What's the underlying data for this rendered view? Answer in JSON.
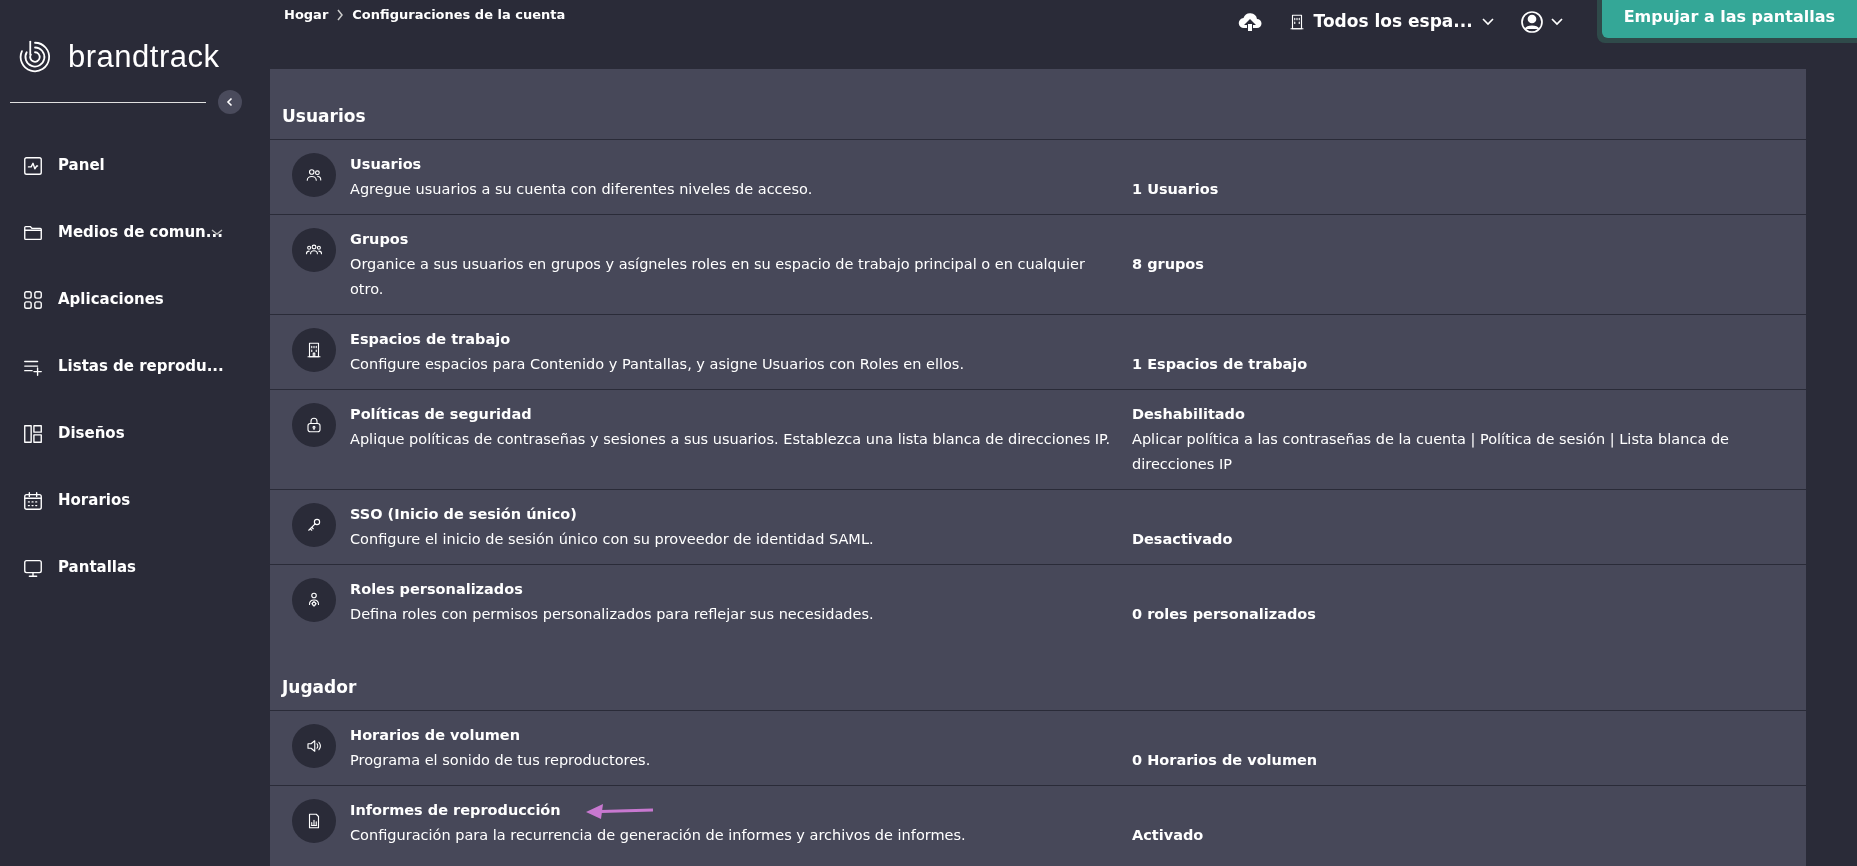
{
  "breadcrumb": [
    {
      "label": "Hogar"
    },
    {
      "label": "Configuraciones de la cuenta"
    }
  ],
  "topbar": {
    "workspace": "Todos los espa...",
    "push_button": "Empujar a las pantallas"
  },
  "sidebar": {
    "logo": "brandtrack",
    "items": [
      {
        "kind": "panel",
        "label": "Panel",
        "has_submenu": false
      },
      {
        "kind": "folder",
        "label": "Medios de comun...",
        "has_submenu": true
      },
      {
        "kind": "apps",
        "label": "Aplicaciones",
        "has_submenu": false
      },
      {
        "kind": "playlist",
        "label": "Listas de reprodu...",
        "has_submenu": false
      },
      {
        "kind": "layout",
        "label": "Diseños",
        "has_submenu": false
      },
      {
        "kind": "calendar",
        "label": "Horarios",
        "has_submenu": false
      },
      {
        "kind": "screen",
        "label": "Pantallas",
        "has_submenu": false
      }
    ]
  },
  "sections": [
    {
      "title": "Usuarios",
      "rows": [
        {
          "kind": "users",
          "title": "Usuarios",
          "description": "Agregue usuarios a su cuenta con diferentes niveles de acceso.",
          "status": "1 Usuarios"
        },
        {
          "kind": "groups",
          "title": "Grupos",
          "description": "Organice a sus usuarios en grupos y asígneles roles en su espacio de trabajo principal o en cualquier otro.",
          "status": "8 grupos"
        },
        {
          "kind": "building",
          "title": "Espacios de trabajo",
          "description": "Configure espacios para Contenido y Pantallas, y asigne Usuarios con Roles en ellos.",
          "status": "1 Espacios de trabajo"
        },
        {
          "kind": "lock",
          "title": "Políticas de seguridad",
          "description": "Aplique políticas de contraseñas y sesiones a sus usuarios. Establezca una lista blanca de direcciones IP.",
          "status": "Deshabilitado",
          "status_detail": "Aplicar política a las contraseñas de la cuenta | Política de sesión | Lista blanca de direcciones IP"
        },
        {
          "kind": "key",
          "title": "SSO (Inicio de sesión único)",
          "description": "Configure el inicio de sesión único con su proveedor de identidad SAML.",
          "status": "Desactivado"
        },
        {
          "kind": "role",
          "title": "Roles personalizados",
          "description": "Defina roles con permisos personalizados para reflejar sus necesidades.",
          "status": "0 roles personalizados"
        }
      ]
    },
    {
      "title": "Jugador",
      "rows": [
        {
          "kind": "speaker",
          "title": "Horarios de volumen",
          "description": "Programa el sonido de tus reproductores.",
          "status": "0 Horarios de volumen"
        },
        {
          "kind": "report",
          "title": "Informes de reproducción",
          "description": "Configuración para la recurrencia de generación de informes y archivos de informes.",
          "status": "Activado",
          "annotated": true
        }
      ]
    }
  ]
}
